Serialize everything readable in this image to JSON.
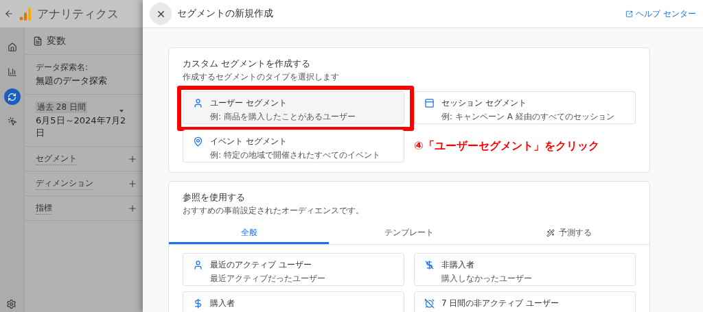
{
  "app_header": {
    "title": "アナリティクス"
  },
  "rail": {
    "items": [
      {
        "kind": "home",
        "selected": false
      },
      {
        "kind": "reports",
        "selected": false
      },
      {
        "kind": "explore",
        "selected": true
      },
      {
        "kind": "advertising",
        "selected": false
      }
    ]
  },
  "variables_panel": {
    "title": "変数",
    "exploration_label": "データ探索名:",
    "exploration_name": "無題のデータ探索",
    "date_badge": "過去 28 日間",
    "date_range": "6月5日～2024年7月2日",
    "sections": [
      {
        "label": "セグメント"
      },
      {
        "label": "ディメンション"
      },
      {
        "label": "指標"
      }
    ]
  },
  "dialog": {
    "title": "セグメントの新規作成",
    "help_link": "ヘルプ センター",
    "custom_card": {
      "title": "カスタム セグメントを作成する",
      "subtitle": "作成するセグメントのタイプを選択します",
      "options": [
        {
          "kind": "user",
          "title": "ユーザー セグメント",
          "example": "例: 商品を購入したことがあるユーザー",
          "highlighted": true
        },
        {
          "kind": "session",
          "title": "セッション セグメント",
          "example": "例: キャンペーン A 経由のすべてのセッション",
          "highlighted": false
        },
        {
          "kind": "event",
          "title": "イベント セグメント",
          "example": "例: 特定の地域で開催されたすべてのイベント",
          "highlighted": false
        }
      ]
    },
    "reference_card": {
      "title": "参照を使用する",
      "subtitle": "おすすめの事前設定されたオーディエンスです。",
      "tabs": [
        {
          "label": "全般",
          "selected": true,
          "kind": "plain"
        },
        {
          "label": "テンプレート",
          "selected": false,
          "kind": "plain"
        },
        {
          "label": "予測する",
          "selected": false,
          "kind": "wand"
        }
      ],
      "options": [
        {
          "kind": "user",
          "title": "最近のアクティブ ユーザー",
          "example": "最近アクティブだったユーザー"
        },
        {
          "kind": "no-dollar",
          "title": "非購入者",
          "example": "購入しなかったユーザー"
        },
        {
          "kind": "dollar",
          "title": "購入者"
        },
        {
          "kind": "alarm-off",
          "title": "7 日間の非アクティブ ユーザー"
        }
      ]
    }
  },
  "annotation": {
    "text": "④「ユーザーセグメント」をクリック"
  }
}
